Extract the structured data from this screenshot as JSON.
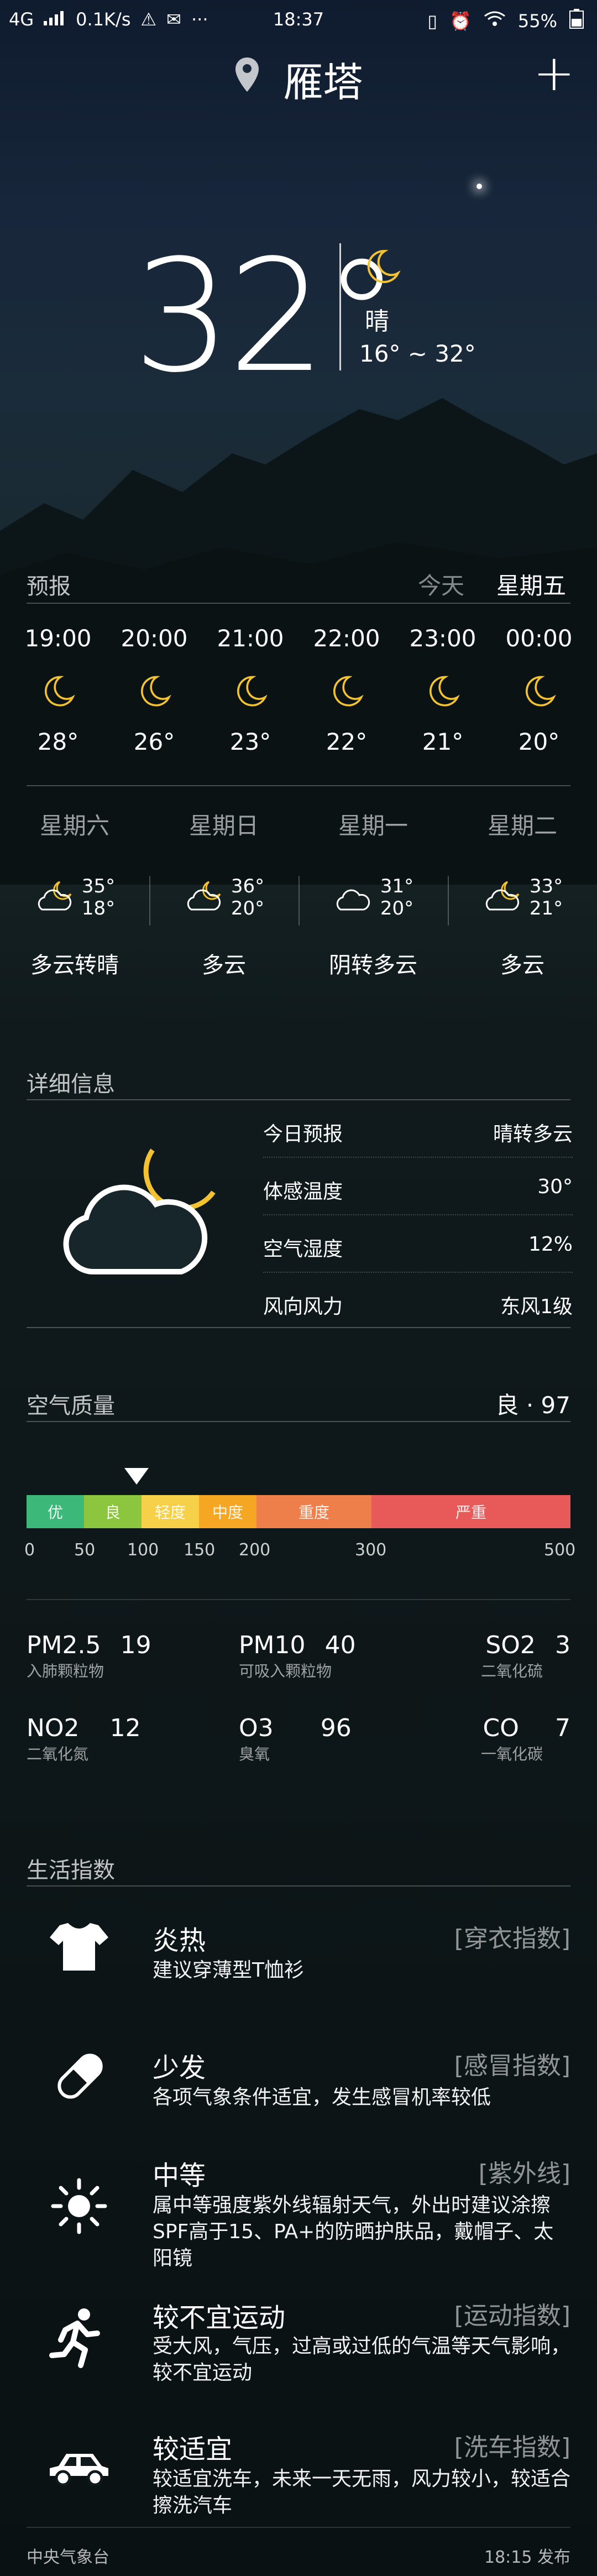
{
  "status": {
    "network": "4G",
    "speed": "0.1K/s",
    "time": "18:37",
    "battery": "55%"
  },
  "header": {
    "city": "雁塔"
  },
  "current": {
    "temp": "32°",
    "condition": "晴",
    "range": "16° ~ 32°"
  },
  "forecast": {
    "title": "预报",
    "today_label": "今天",
    "weekday_label": "星期五",
    "hourly": [
      {
        "time": "19:00",
        "temp": "28°"
      },
      {
        "time": "20:00",
        "temp": "26°"
      },
      {
        "time": "21:00",
        "temp": "23°"
      },
      {
        "time": "22:00",
        "temp": "22°"
      },
      {
        "time": "23:00",
        "temp": "21°"
      },
      {
        "time": "00:00",
        "temp": "20°"
      }
    ],
    "daily": [
      {
        "day": "星期六",
        "high": "35°",
        "low": "18°",
        "desc": "多云转晴"
      },
      {
        "day": "星期日",
        "high": "36°",
        "low": "20°",
        "desc": "多云"
      },
      {
        "day": "星期一",
        "high": "31°",
        "low": "20°",
        "desc": "阴转多云"
      },
      {
        "day": "星期二",
        "high": "33°",
        "low": "21°",
        "desc": "多云"
      }
    ]
  },
  "details": {
    "title": "详细信息",
    "rows": [
      {
        "key": "今日预报",
        "value": "晴转多云"
      },
      {
        "key": "体感温度",
        "value": "30°"
      },
      {
        "key": "空气湿度",
        "value": "12%"
      },
      {
        "key": "风向风力",
        "value": "东风1级"
      }
    ]
  },
  "air": {
    "title": "空气质量",
    "summary": "良 · 97",
    "segments": [
      "优",
      "良",
      "轻度",
      "中度",
      "重度",
      "严重"
    ],
    "colors": [
      "#3cb878",
      "#8cc63f",
      "#f7d04a",
      "#f5a623",
      "#ee7e4a",
      "#e85a5a"
    ],
    "scale": [
      "0",
      "50",
      "100",
      "150",
      "200",
      "300",
      "500"
    ],
    "aqi_value": 97,
    "pollutants": [
      {
        "name": "PM2.5",
        "value": "19",
        "sub": "入肺颗粒物"
      },
      {
        "name": "PM10",
        "value": "40",
        "sub": "可吸入颗粒物"
      },
      {
        "name": "SO2",
        "value": "3",
        "sub": "二氧化硫"
      },
      {
        "name": "NO2",
        "value": "12",
        "sub": "二氧化氮"
      },
      {
        "name": "O3",
        "value": "96",
        "sub": "臭氧"
      },
      {
        "name": "CO",
        "value": "7",
        "sub": "一氧化碳"
      }
    ]
  },
  "life": {
    "title": "生活指数",
    "items": [
      {
        "icon": "tshirt-icon",
        "title": "炎热",
        "tag": "[穿衣指数]",
        "desc": "建议穿薄型T恤衫"
      },
      {
        "icon": "pill-icon",
        "title": "少发",
        "tag": "[感冒指数]",
        "desc": "各项气象条件适宜，发生感冒机率较低"
      },
      {
        "icon": "sun-icon",
        "title": "中等",
        "tag": "[紫外线]",
        "desc": "属中等强度紫外线辐射天气，外出时建议涂擦SPF高于15、PA+的防晒护肤品，戴帽子、太阳镜"
      },
      {
        "icon": "runner-icon",
        "title": "较不宜运动",
        "tag": "[运动指数]",
        "desc": "受大风，气压，过高或过低的气温等天气影响，较不宜运动"
      },
      {
        "icon": "car-icon",
        "title": "较适宜",
        "tag": "[洗车指数]",
        "desc": "较适宜洗车，未来一天无雨，风力较小，较适合擦洗汽车"
      }
    ]
  },
  "footer": {
    "source": "中央气象台",
    "published": "18:15 发布"
  }
}
